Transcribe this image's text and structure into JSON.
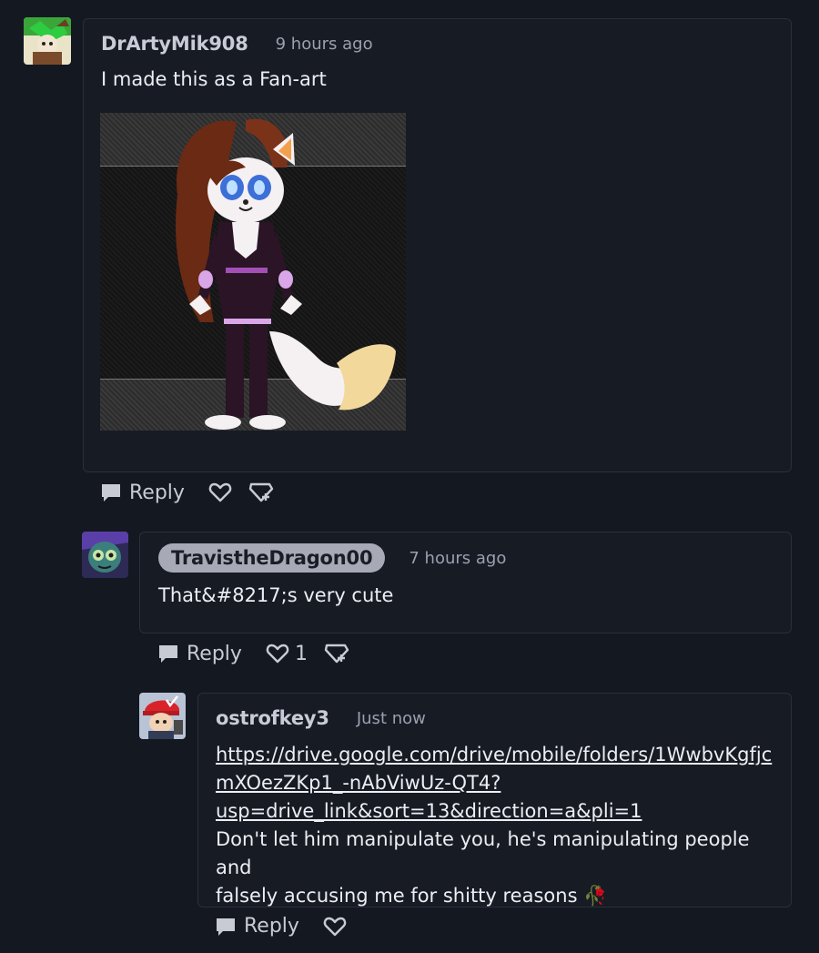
{
  "comments": [
    {
      "author": "DrArtyMik908",
      "time": "9 hours ago",
      "text": "I made this as a Fan-art",
      "reply_label": "Reply",
      "likes": ""
    },
    {
      "author": "TravistheDragon00",
      "time": "7 hours ago",
      "text": "That&#8217;s very cute",
      "reply_label": "Reply",
      "likes": "1"
    },
    {
      "author": "ostrofkey3",
      "time": "Just now",
      "link_lines": [
        "https://drive.google.com/drive/mobile/folders/1WwbvKgfjc",
        "mXOezZKp1_-nAbViwUz-QT4?",
        "usp=drive_link&sort=13&direction=a&pli=1"
      ],
      "text_lines": [
        "Don't let him manipulate you, he's manipulating people and",
        "falsely accusing me for shitty reasons"
      ],
      "emoji": "🥀",
      "reply_label": "Reply"
    }
  ],
  "icons": {
    "reply": "speech-bubble-icon",
    "like": "heart-icon",
    "award": "award-icon"
  },
  "colors": {
    "background": "#141821",
    "card": "#171b24",
    "border": "#2a2f3b",
    "highlight_pill": "#a7aab6"
  }
}
